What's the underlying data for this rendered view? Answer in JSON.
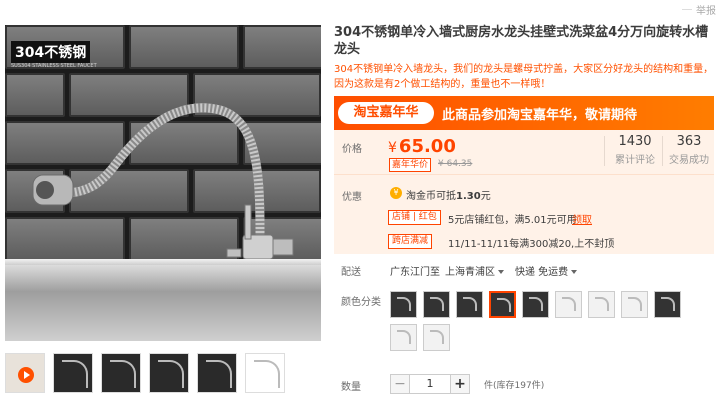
{
  "report_label": "举报",
  "gallery": {
    "badge_text": "304不锈钢",
    "badge_sub": "SUS304 STAINLESS STEEL FAUCET",
    "thumbnail_count": 6
  },
  "product": {
    "title": "304不锈钢单冷入墙式厨房水龙头挂壁式洗菜盆4分万向旋转水槽龙头",
    "subtitle": "304不锈钢单冷入墙龙头，我们的龙头是螺母式拧盖，大家区分好龙头的结构和重量，因为这款是有2个做工结构的，重量也不一样哦！"
  },
  "banner": {
    "logo_text": "淘宝嘉年华",
    "text": "此商品参加淘宝嘉年华，敬请期待"
  },
  "price": {
    "label": "价格",
    "currency": "¥",
    "value": "65.00",
    "tag": "嘉年华价",
    "original": "¥ 64.35",
    "reviews_count": "1430",
    "reviews_label": "累计评论",
    "sales_count": "363",
    "sales_label": "交易成功"
  },
  "discount": {
    "label": "优惠",
    "coin_text_prefix": "淘金币可抵",
    "coin_amount": "1.30",
    "coin_text_suffix": "元",
    "shop_tag": "店铺",
    "redpack_tag": "红包",
    "shop_coupon": "5元店铺红包，满5.01元可用",
    "get_link": "领取",
    "cross_tag": "跨店满减",
    "cross_text": "11/11-11/11每满300减20,上不封顶"
  },
  "delivery": {
    "label": "配送",
    "from": "广东江门",
    "to_label": "至",
    "to": "上海青浦区",
    "method": "快递 免运费"
  },
  "options": {
    "label": "颜色分类",
    "swatch_count": 11,
    "selected_index": 3
  },
  "quantity": {
    "label": "数量",
    "minus": "−",
    "value": "1",
    "plus": "+",
    "stock": "件(库存197件)"
  },
  "colors": {
    "accent": "#ff4400",
    "banner_start": "#ff4e00",
    "panel_bg": "#fff2e8"
  }
}
